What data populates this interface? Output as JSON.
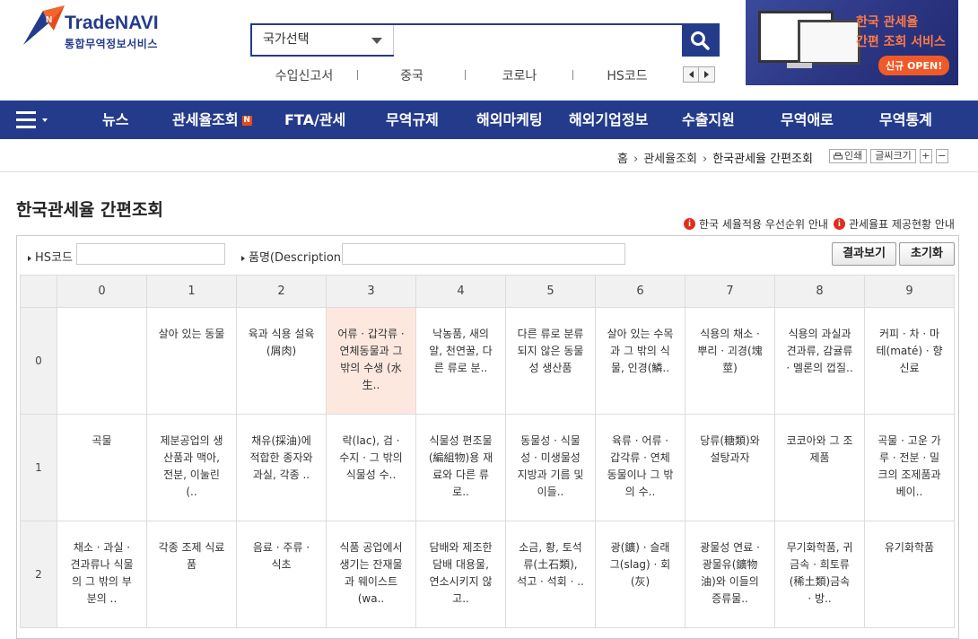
{
  "logo": {
    "brand": "TradeNAVI",
    "subtitle": "통합무역정보서비스"
  },
  "search": {
    "country_select": "국가선택",
    "input_value": ""
  },
  "quick_links": [
    "수입신고서",
    "중국",
    "코로나",
    "HS코드"
  ],
  "banner": {
    "line1": "한국 관세율",
    "line2": "간편 조회 서비스",
    "badge": "신규 OPEN!"
  },
  "nav": {
    "items": [
      "뉴스",
      "관세율조회",
      "FTA/관세",
      "무역규제",
      "해외마케팅",
      "해외기업정보",
      "수출지원",
      "무역애로",
      "무역통계"
    ],
    "new_badge": "N"
  },
  "breadcrumb": {
    "home": "홈",
    "level1": "관세율조회",
    "current": "한국관세율 간편조회"
  },
  "utilities": {
    "print": "인쇄",
    "font_size": "글씨크기",
    "plus": "+",
    "minus": "−"
  },
  "page": {
    "title": "한국관세율 간편조회"
  },
  "info_links": [
    "한국 세율적용 우선순위 안내",
    "관세율표 제공현황 안내"
  ],
  "form": {
    "hs_label": "HS코드",
    "hs_value": "",
    "desc_label": "품명(Description)",
    "desc_value": "",
    "view_button": "결과보기",
    "reset_button": "초기화"
  },
  "grid": {
    "columns": [
      "0",
      "1",
      "2",
      "3",
      "4",
      "5",
      "6",
      "7",
      "8",
      "9"
    ],
    "rows": [
      {
        "label": "0",
        "cells": [
          "",
          "살아 있는 동물",
          "육과 식용 설육(屑肉)",
          "어류 · 갑각류 · 연체동물과 그 밖의 수생 (水生..",
          "낙농품, 새의 알, 천연꿀, 다른 류로 분..",
          "다른 류로 분류되지 않은 동물성 생산품",
          "살아 있는 수목과 그 밖의 식물, 인경(鱗..",
          "식용의 채소 · 뿌리 · 괴경(塊莖)",
          "식용의 과실과 견과류, 감귤류 · 멜론의 껍질..",
          "커피 · 차 · 마테(maté) · 향신료"
        ]
      },
      {
        "label": "1",
        "cells": [
          "곡물",
          "제분공업의 생산품과 맥아, 전분, 이눌린(..",
          "채유(採油)에 적합한 종자와 과실, 각종 ..",
          "락(lac), 검 · 수지 · 그 밖의 식물성 수..",
          "식물성 편조물(編組物)용 재료와 다른 류로..",
          "동물성 · 식물성 · 미생물성 지방과 기름 및 이들..",
          "육류 · 어류 · 갑각류 · 연체동물이나 그 밖의 수..",
          "당류(糖類)와 설탕과자",
          "코코아와 그 조제품",
          "곡물 · 고운 가루 · 전분 · 밀크의 조제품과 베이.."
        ]
      },
      {
        "label": "2",
        "cells": [
          "채소 · 과실 · 견과류나 식물의 그 밖의 부분의 ..",
          "각종 조제 식료품",
          "음료 · 주류 · 식초",
          "식품 공업에서 생기는 잔재물과 웨이스트(wa..",
          "담배와 제조한 담배 대용물, 연소시키지 않고..",
          "소금, 황, 토석류(土石類), 석고 · 석회 · ..",
          "광(鑛) · 슬래그(slag) · 회(灰)",
          "광물성 연료 · 광물유(鑛物油)와 이들의 증류물..",
          "무기화학품, 귀금속 · 희토류(稀土類)금속 · 방..",
          "유기화학품"
        ]
      }
    ],
    "highlight": {
      "row": 0,
      "col": 3
    }
  }
}
